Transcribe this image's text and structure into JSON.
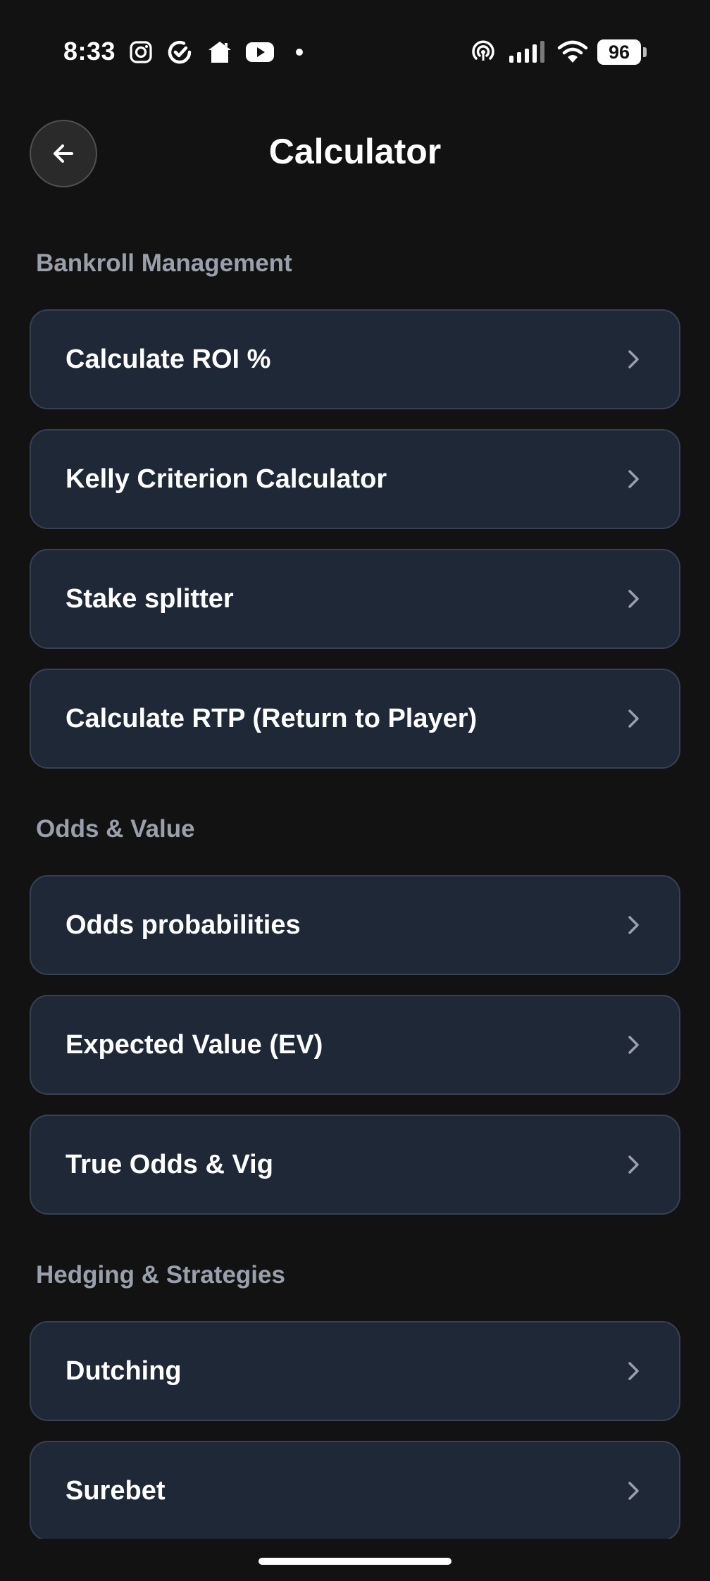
{
  "status_bar": {
    "time": "8:33",
    "battery": "96",
    "icons": [
      "instagram-icon",
      "refresh-app-icon",
      "home-app-icon",
      "youtube-icon",
      "notification-dot-icon",
      "hotspot-icon",
      "signal-icon",
      "wifi-icon",
      "battery-icon"
    ]
  },
  "header": {
    "title": "Calculator",
    "back_icon": "arrow-left-icon"
  },
  "sections": [
    {
      "title": "Bankroll Management",
      "items": [
        {
          "label": "Calculate ROI %"
        },
        {
          "label": "Kelly Criterion Calculator"
        },
        {
          "label": "Stake splitter"
        },
        {
          "label": "Calculate RTP (Return to Player)"
        }
      ]
    },
    {
      "title": "Odds & Value",
      "items": [
        {
          "label": "Odds probabilities"
        },
        {
          "label": "Expected Value (EV)"
        },
        {
          "label": "True Odds & Vig"
        }
      ]
    },
    {
      "title": "Hedging & Strategies",
      "items": [
        {
          "label": "Dutching"
        },
        {
          "label": "Surebet"
        }
      ]
    }
  ],
  "colors": {
    "background": "#121212",
    "card": "#1f2837",
    "card_border": "#384152",
    "section_title": "#9aa0ab",
    "chevron": "#9aa0ab"
  }
}
